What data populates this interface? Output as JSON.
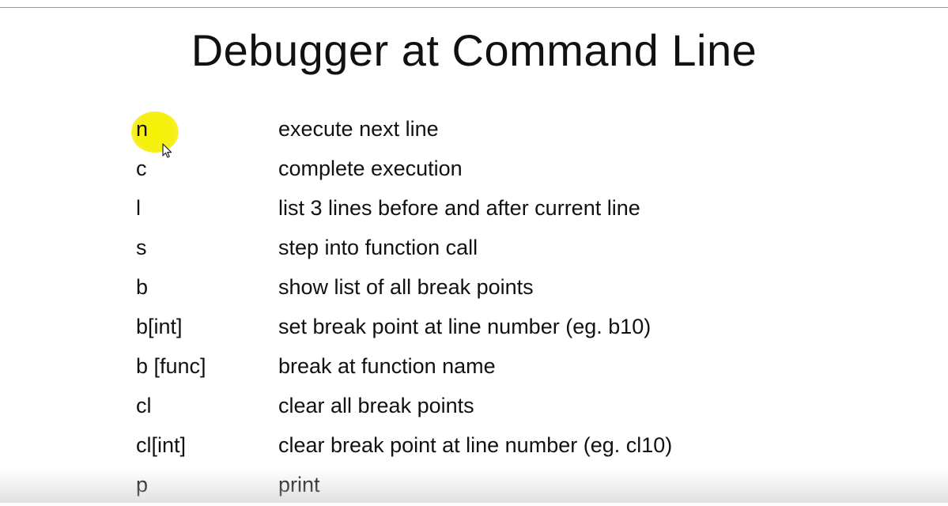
{
  "slide": {
    "title": "Debugger at Command Line",
    "commands": [
      {
        "command": "n",
        "description": "execute next line"
      },
      {
        "command": "c",
        "description": "complete execution"
      },
      {
        "command": "l",
        "description": "list 3 lines before and after current line"
      },
      {
        "command": "s",
        "description": "step into function call"
      },
      {
        "command": "b",
        "description": "show list of all break points"
      },
      {
        "command": "b[int]",
        "description": "set break point at line number (eg. b10)"
      },
      {
        "command": "b [func]",
        "description": "break at function name"
      },
      {
        "command": "cl",
        "description": "clear all break points"
      },
      {
        "command": "cl[int]",
        "description": "clear break point at line number (eg. cl10)"
      },
      {
        "command": "p",
        "description": "print"
      }
    ]
  },
  "colors": {
    "highlight": "#f5ef14",
    "text": "#111111",
    "background": "#ffffff"
  },
  "icons": {
    "pointer": "mouse-pointer-icon",
    "highlight": "cursor-highlight"
  }
}
